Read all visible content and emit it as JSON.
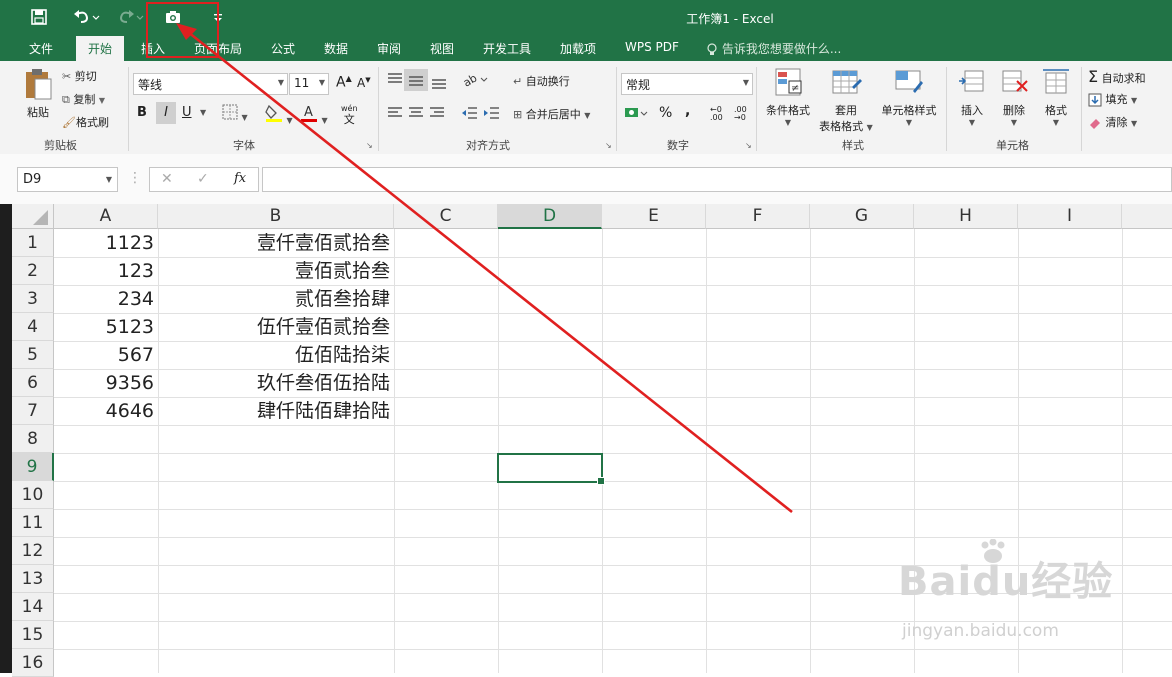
{
  "window": {
    "title": "工作簿1 - Excel"
  },
  "ribbon_tabs": [
    "文件",
    "开始",
    "插入",
    "页面布局",
    "公式",
    "数据",
    "审阅",
    "视图",
    "开发工具",
    "加载项",
    "WPS PDF"
  ],
  "active_tab": "开始",
  "tell_me": "告诉我您想要做什么...",
  "clipboard": {
    "paste": "粘贴",
    "cut": "剪切",
    "copy": "复制",
    "format_painter": "格式刷",
    "group": "剪贴板"
  },
  "font": {
    "name": "等线",
    "size": "11",
    "bold": "B",
    "italic": "I",
    "underline": "U",
    "wen": "wén",
    "wen_char": "文",
    "group": "字体"
  },
  "alignment": {
    "wrap": "自动换行",
    "merge": "合并后居中",
    "group": "对齐方式"
  },
  "number": {
    "format": "常规",
    "percent": "%",
    "comma": ",",
    "group": "数字"
  },
  "styles": {
    "conditional": "条件格式",
    "table_1": "套用",
    "table_2": "表格格式",
    "cell_styles": "单元格样式",
    "group": "样式"
  },
  "cells": {
    "insert": "插入",
    "delete": "删除",
    "format": "格式",
    "group": "单元格"
  },
  "editing": {
    "autosum": "自动求和",
    "fill": "填充",
    "clear": "清除"
  },
  "formula_bar": {
    "name_box": "D9",
    "fx": "fx",
    "value": ""
  },
  "columns": [
    "A",
    "B",
    "C",
    "D",
    "E",
    "F",
    "G",
    "H",
    "I"
  ],
  "selected_cell": {
    "column": "D",
    "row": "9"
  },
  "rows": [
    "1",
    "2",
    "3",
    "4",
    "5",
    "6",
    "7",
    "8",
    "9",
    "10",
    "11",
    "12",
    "13",
    "14",
    "15",
    "16"
  ],
  "data": [
    {
      "a": "1123",
      "b": "壹仟壹佰贰拾叁"
    },
    {
      "a": "123",
      "b": "壹佰贰拾叁"
    },
    {
      "a": "234",
      "b": "贰佰叁拾肆"
    },
    {
      "a": "5123",
      "b": "伍仟壹佰贰拾叁"
    },
    {
      "a": "567",
      "b": "伍佰陆拾柒"
    },
    {
      "a": "9356",
      "b": "玖仟叁佰伍拾陆"
    },
    {
      "a": "4646",
      "b": "肆仟陆佰肆拾陆"
    }
  ],
  "watermark": {
    "brand": "Baidu经验",
    "url": "jingyan.baidu.com"
  },
  "colors": {
    "excel_green": "#217346",
    "annotation_red": "#e02020"
  }
}
